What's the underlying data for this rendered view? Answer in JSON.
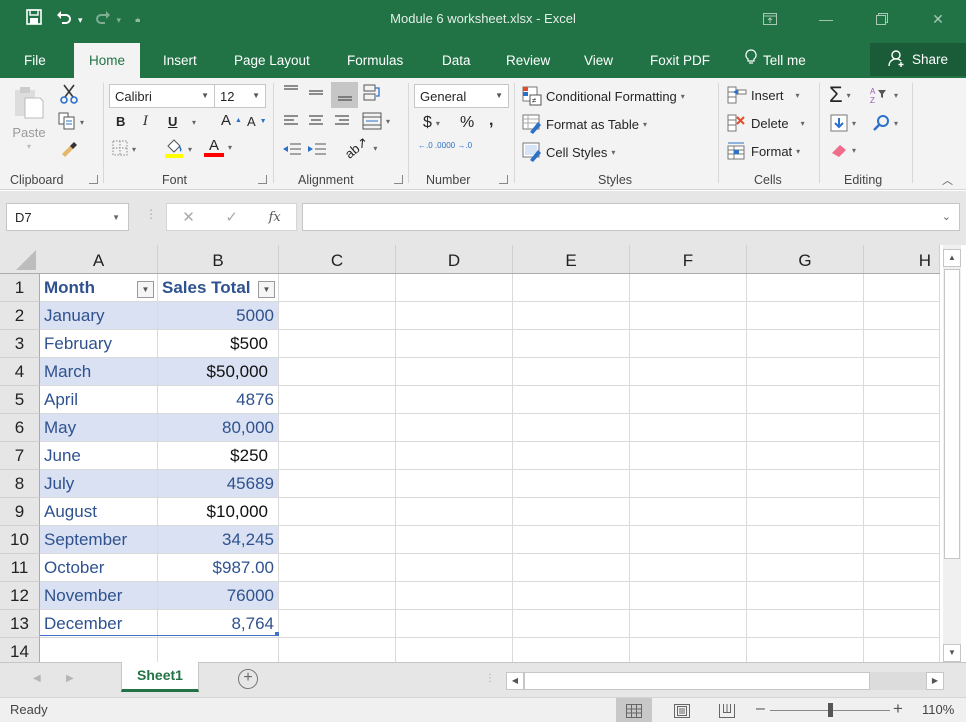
{
  "window": {
    "title": "Module 6 worksheet.xlsx  -  Excel",
    "controls": [
      "ribbon-display-options",
      "minimize",
      "restore",
      "close"
    ]
  },
  "quick_access": {
    "save_icon": "save-icon",
    "undo_icon": "undo-icon",
    "redo_icon": "redo-icon",
    "customize_icon": "customize-qat-icon"
  },
  "tabs": {
    "items": [
      "File",
      "Home",
      "Insert",
      "Page Layout",
      "Formulas",
      "Data",
      "Review",
      "View",
      "Foxit PDF"
    ],
    "active": "Home",
    "tell_me": "Tell me",
    "share": "Share"
  },
  "ribbon": {
    "clipboard": {
      "label": "Clipboard",
      "paste": "Paste"
    },
    "font": {
      "label": "Font",
      "font_name": "Calibri",
      "font_size": "12",
      "bold": "B",
      "italic": "I",
      "underline": "U",
      "grow": "A",
      "shrink": "A",
      "font_color": "A"
    },
    "alignment": {
      "label": "Alignment"
    },
    "number": {
      "label": "Number",
      "format": "General",
      "currency": "$",
      "percent": "%",
      "comma": ",",
      "inc_decimal": "←.0 .00",
      "dec_decimal": ".00 →.0"
    },
    "styles": {
      "label": "Styles",
      "conditional_formatting": "Conditional Formatting",
      "format_as_table": "Format as Table",
      "cell_styles": "Cell Styles"
    },
    "cells": {
      "label": "Cells",
      "insert": "Insert",
      "delete": "Delete",
      "format": "Format"
    },
    "editing": {
      "label": "Editing",
      "autosum": "Σ"
    }
  },
  "formula_bar": {
    "name_box": "D7",
    "cancel": "✕",
    "enter": "✓",
    "fx": "fx",
    "value": ""
  },
  "sheet": {
    "columns": [
      "A",
      "B",
      "C",
      "D",
      "E",
      "F",
      "G",
      "H"
    ],
    "rows": [
      "1",
      "2",
      "3",
      "4",
      "5",
      "6",
      "7",
      "8",
      "9",
      "10",
      "11",
      "12",
      "13",
      "14"
    ],
    "table_headers": [
      "Month",
      "Sales Total"
    ],
    "table_rows": [
      {
        "month": "January",
        "sales": "5000",
        "sales_black": false
      },
      {
        "month": "February",
        "sales": "$500",
        "sales_black": true
      },
      {
        "month": "March",
        "sales": "$50,000",
        "sales_black": true
      },
      {
        "month": "April",
        "sales": "4876",
        "sales_black": false
      },
      {
        "month": "May",
        "sales": "80,000",
        "sales_black": false
      },
      {
        "month": "June",
        "sales": "$250",
        "sales_black": true
      },
      {
        "month": "July",
        "sales": "45689",
        "sales_black": false
      },
      {
        "month": "August",
        "sales": "$10,000",
        "sales_black": true
      },
      {
        "month": "September",
        "sales": "34,245",
        "sales_black": false
      },
      {
        "month": "October",
        "sales": "$987.00",
        "sales_black": false
      },
      {
        "month": "November",
        "sales": "76000",
        "sales_black": false
      },
      {
        "month": "December",
        "sales": "8,764",
        "sales_black": false
      }
    ],
    "selected_cell": "D7"
  },
  "sheet_tabs": {
    "items": [
      "Sheet1"
    ],
    "active": "Sheet1",
    "add_label": "+"
  },
  "status_bar": {
    "status": "Ready",
    "zoom": "110%",
    "zoom_percent": 110,
    "views": [
      "Normal",
      "Page Layout",
      "Page Break Preview"
    ],
    "active_view": "Normal"
  },
  "colors": {
    "excel_green": "#217346",
    "table_band": "#d9e1f2",
    "table_text": "#2f528f",
    "table_border": "#4472c4"
  }
}
